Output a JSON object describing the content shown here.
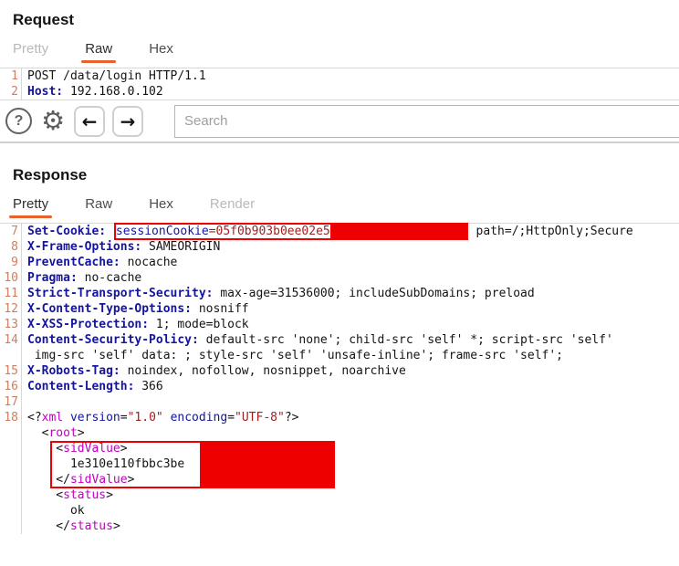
{
  "colors": {
    "accent_orange": "#e8622d",
    "redaction_red": "#ee0000",
    "header_name_navy": "#14149e",
    "value_dark_red": "#a32020",
    "xml_tag_magenta": "#bf00bf",
    "line_number_orange": "#cf7f5f"
  },
  "request": {
    "title": "Request",
    "tabs": [
      {
        "label": "Pretty",
        "state": "disabled"
      },
      {
        "label": "Raw",
        "state": "active"
      },
      {
        "label": "Hex",
        "state": "normal"
      }
    ],
    "rows": [
      {
        "num": "1",
        "segs": [
          {
            "t": "POST /data/login HTTP/1.1",
            "c": "plain"
          }
        ]
      },
      {
        "num": "2",
        "segs": [
          {
            "t": "Host:",
            "c": "hname"
          },
          {
            "t": " 192.168.0.102",
            "c": "plain"
          }
        ]
      }
    ]
  },
  "toolbar": {
    "help_icon": "?",
    "gear_icon": "⚙",
    "back_icon": "←",
    "forward_icon": "→",
    "search_placeholder": "Search"
  },
  "response": {
    "title": "Response",
    "tabs": [
      {
        "label": "Pretty",
        "state": "active"
      },
      {
        "label": "Raw",
        "state": "normal"
      },
      {
        "label": "Hex",
        "state": "normal"
      },
      {
        "label": "Render",
        "state": "disabled"
      }
    ],
    "rows": [
      {
        "num": "7",
        "segs": [
          {
            "t": "Set-Cookie:",
            "c": "hname"
          },
          {
            "t": " ",
            "c": "plain"
          },
          {
            "type": "redact",
            "fill": 149,
            "segs": [
              {
                "t": "sessionCookie",
                "c": "cname"
              },
              {
                "t": "=05f0b903b0ee02e5",
                "c": "rval"
              }
            ]
          },
          {
            "t": " path=/;HttpOnly;Secure",
            "c": "plain"
          }
        ]
      },
      {
        "num": "8",
        "segs": [
          {
            "t": "X-Frame-Options:",
            "c": "hname"
          },
          {
            "t": " SAMEORIGIN",
            "c": "plain"
          }
        ]
      },
      {
        "num": "9",
        "segs": [
          {
            "t": "PreventCache:",
            "c": "hname"
          },
          {
            "t": " nocache",
            "c": "plain"
          }
        ]
      },
      {
        "num": "10",
        "segs": [
          {
            "t": "Pragma:",
            "c": "hname"
          },
          {
            "t": " no-cache",
            "c": "plain"
          }
        ]
      },
      {
        "num": "11",
        "segs": [
          {
            "t": "Strict-Transport-Security:",
            "c": "hname"
          },
          {
            "t": " max-age=31536000; includeSubDomains; preload",
            "c": "plain"
          }
        ]
      },
      {
        "num": "12",
        "segs": [
          {
            "t": "X-Content-Type-Options:",
            "c": "hname"
          },
          {
            "t": " nosniff",
            "c": "plain"
          }
        ]
      },
      {
        "num": "13",
        "segs": [
          {
            "t": "X-XSS-Protection:",
            "c": "hname"
          },
          {
            "t": " 1; mode=block",
            "c": "plain"
          }
        ]
      },
      {
        "num": "14",
        "segs": [
          {
            "t": "Content-Security-Policy:",
            "c": "hname"
          },
          {
            "t": " default-src 'none'; child-src 'self' *; script-src 'self'",
            "c": "plain"
          }
        ]
      },
      {
        "num": "",
        "segs": [
          {
            "t": " img-src 'self' data: ; style-src 'self' 'unsafe-inline'; frame-src 'self';",
            "c": "plain"
          }
        ]
      },
      {
        "num": "15",
        "segs": [
          {
            "t": "X-Robots-Tag:",
            "c": "hname"
          },
          {
            "t": " noindex, nofollow, nosnippet, noarchive",
            "c": "plain"
          }
        ]
      },
      {
        "num": "16",
        "segs": [
          {
            "t": "Content-Length:",
            "c": "hname"
          },
          {
            "t": " 366",
            "c": "plain"
          }
        ]
      },
      {
        "num": "17",
        "segs": []
      },
      {
        "num": "18",
        "segs": [
          {
            "t": "<?",
            "c": "plain"
          },
          {
            "t": "xml",
            "c": "xtag"
          },
          {
            "t": " ",
            "c": "plain"
          },
          {
            "t": "version",
            "c": "attr"
          },
          {
            "t": "=",
            "c": "plain"
          },
          {
            "t": "\"1.0\"",
            "c": "rval"
          },
          {
            "t": " ",
            "c": "plain"
          },
          {
            "t": "encoding",
            "c": "attr"
          },
          {
            "t": "=",
            "c": "plain"
          },
          {
            "t": "\"UTF-8\"",
            "c": "rval"
          },
          {
            "t": "?>",
            "c": "plain"
          }
        ]
      },
      {
        "num": "",
        "segs": [
          {
            "t": "  <",
            "c": "plain"
          },
          {
            "t": "root",
            "c": "xtag"
          },
          {
            "t": ">",
            "c": "plain"
          }
        ]
      },
      {
        "num": "",
        "segs": [
          {
            "t": "    <",
            "c": "plain"
          },
          {
            "t": "sidValue",
            "c": "xtag"
          },
          {
            "t": ">",
            "c": "plain"
          }
        ]
      },
      {
        "num": "",
        "segs": [
          {
            "t": "      1e310e110fbbc3be",
            "c": "plain"
          }
        ]
      },
      {
        "num": "",
        "segs": [
          {
            "t": "    </",
            "c": "plain"
          },
          {
            "t": "sidValue",
            "c": "xtag"
          },
          {
            "t": ">",
            "c": "plain"
          }
        ]
      },
      {
        "num": "",
        "segs": [
          {
            "t": "    <",
            "c": "plain"
          },
          {
            "t": "status",
            "c": "xtag"
          },
          {
            "t": ">",
            "c": "plain"
          }
        ]
      },
      {
        "num": "",
        "segs": [
          {
            "t": "      ok",
            "c": "plain"
          }
        ]
      },
      {
        "num": "",
        "segs": [
          {
            "t": "    </",
            "c": "plain"
          },
          {
            "t": "status",
            "c": "xtag"
          },
          {
            "t": ">",
            "c": "plain"
          }
        ]
      }
    ]
  }
}
